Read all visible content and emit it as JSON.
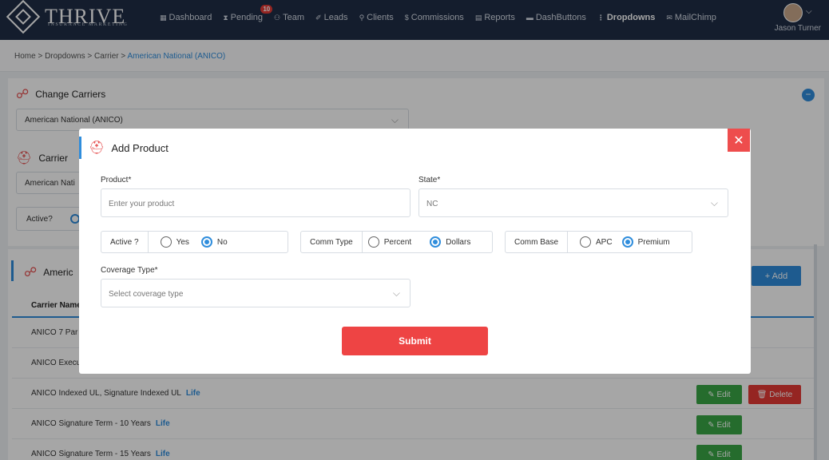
{
  "brand": {
    "name": "THRIVE",
    "tagline": "INSURANCE MARKETING"
  },
  "nav": {
    "items": [
      {
        "label": "Dashboard",
        "icon": "▦"
      },
      {
        "label": "Pending",
        "icon": "⧗"
      },
      {
        "label": "Team",
        "icon": "⚇"
      },
      {
        "label": "Leads",
        "icon": "✐"
      },
      {
        "label": "Clients",
        "icon": "⚲"
      },
      {
        "label": "Commissions",
        "icon": "$"
      },
      {
        "label": "Reports",
        "icon": "▤"
      },
      {
        "label": "DashButtons",
        "icon": "▬"
      },
      {
        "label": "Dropdowns",
        "icon": "⋮"
      },
      {
        "label": "MailChimp",
        "icon": "✉"
      }
    ],
    "pending_badge": "10",
    "active": "Dropdowns"
  },
  "user": {
    "name": "Jason Turner"
  },
  "breadcrumb": {
    "path": "Home > Dropdowns > Carrier > ",
    "current": "American National (ANICO)"
  },
  "background": {
    "change_carriers_title": "Change Carriers",
    "change_carriers_value": "American National (ANICO)",
    "carrier_title": "Carrier",
    "carrier_value": "American Nati",
    "active_label": "Active?",
    "products_title": "Americ",
    "add_label": "+ Add",
    "table_header": "Carrier Name",
    "rows": [
      {
        "name": "ANICO 7 Par",
        "type": ""
      },
      {
        "name": "ANICO Execu",
        "type": ""
      },
      {
        "name": "ANICO Indexed UL, Signature Indexed UL",
        "type": "Life"
      },
      {
        "name": "ANICO Signature Term - 10 Years",
        "type": "Life"
      },
      {
        "name": "ANICO Signature Term - 15 Years",
        "type": "Life"
      }
    ],
    "edit_label": "Edit",
    "delete_label": "Delete"
  },
  "modal": {
    "title": "Add Product",
    "product_label": "Product*",
    "product_placeholder": "Enter your product",
    "state_label": "State*",
    "state_value": "NC",
    "active_group": {
      "label": "Active ?",
      "options": [
        "Yes",
        "No"
      ],
      "selected": "No"
    },
    "comm_type_group": {
      "label": "Comm Type",
      "options": [
        "Percent",
        "Dollars"
      ],
      "selected": "Dollars"
    },
    "comm_base_group": {
      "label": "Comm Base",
      "options": [
        "APC",
        "Premium"
      ],
      "selected": "Premium"
    },
    "coverage_label": "Coverage Type*",
    "coverage_placeholder": "Select coverage type",
    "submit_label": "Submit"
  },
  "colors": {
    "nav_bg": "#1f2d45",
    "accent_blue": "#2f8ddc",
    "accent_red": "#ee4444",
    "edit_green": "#3aa745"
  }
}
